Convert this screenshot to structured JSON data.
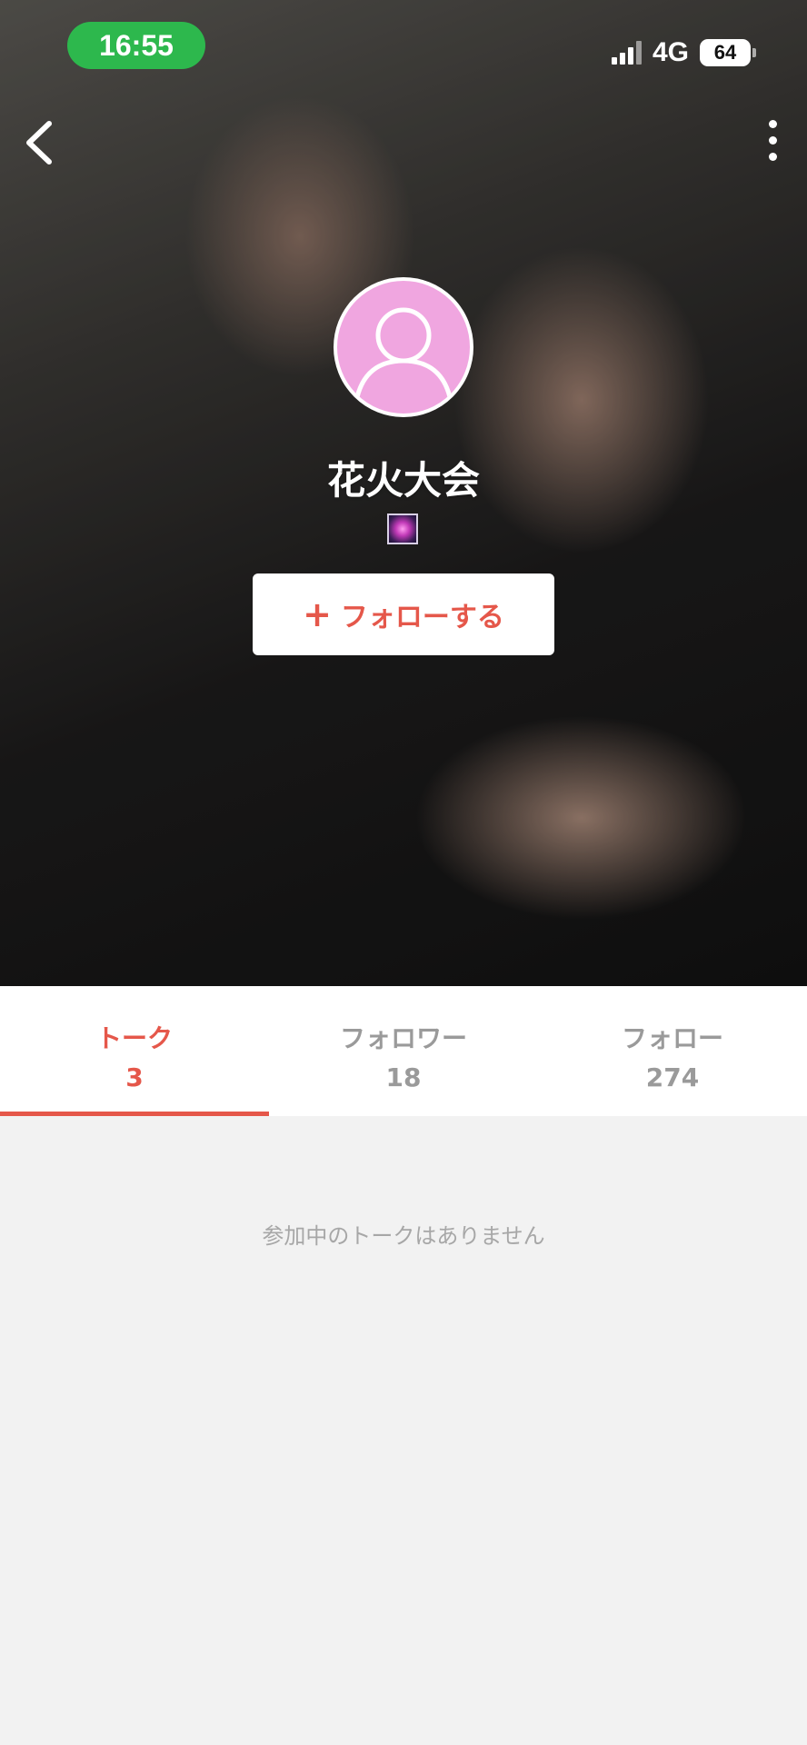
{
  "status_bar": {
    "time": "16:55",
    "network": "4G",
    "battery": "64"
  },
  "profile": {
    "name": "花火大会",
    "emoji_icon": "fireworks-icon",
    "follow_label": "フォローする",
    "follow_icon": "+"
  },
  "tabs": [
    {
      "label": "トーク",
      "count": "3",
      "active": true
    },
    {
      "label": "フォロワー",
      "count": "18",
      "active": false
    },
    {
      "label": "フォロー",
      "count": "274",
      "active": false
    }
  ],
  "empty_state": {
    "message": "参加中のトークはありません"
  },
  "colors": {
    "accent": "#e5574a",
    "status_time_bg": "#2db84d",
    "avatar_bg": "#f0a6e0"
  }
}
